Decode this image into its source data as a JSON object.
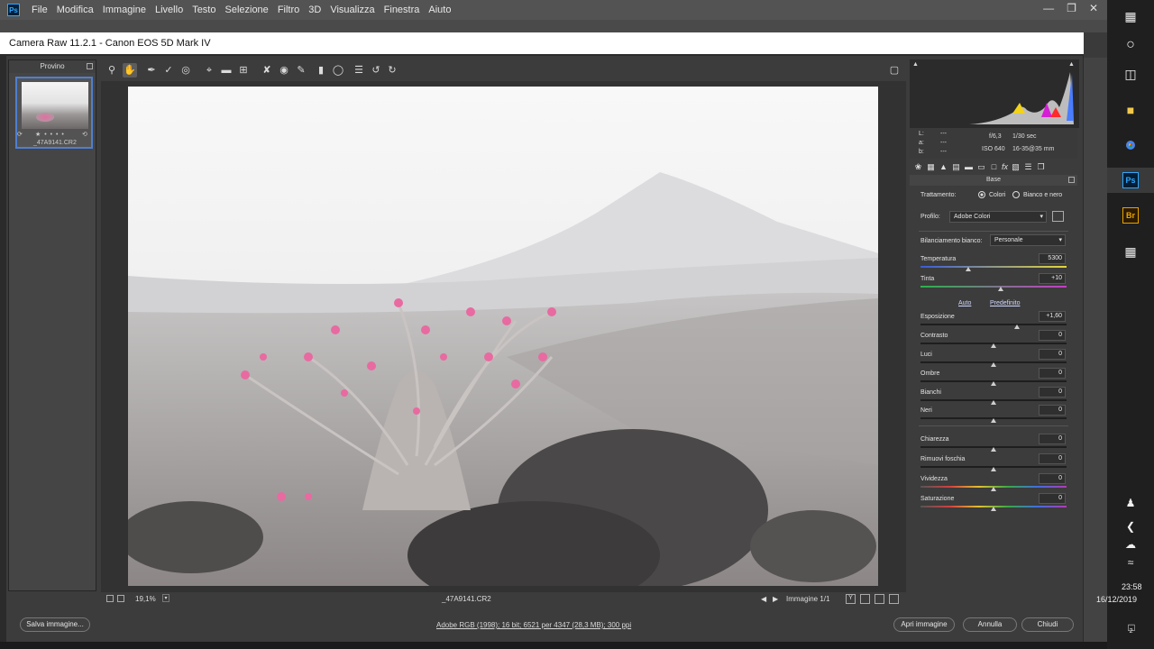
{
  "ps_menu": [
    "File",
    "Modifica",
    "Immagine",
    "Livello",
    "Testo",
    "Selezione",
    "Filtro",
    "3D",
    "Visualizza",
    "Finestra",
    "Aiuto"
  ],
  "ps_logo": "Ps",
  "window_title": "Camera Raw 11.2.1  -  Canon EOS 5D Mark IV",
  "filmstrip": {
    "title": "Provino",
    "filename": "_47A9141.CR2",
    "stars": "★ • • • •"
  },
  "readout": {
    "L": "L:",
    "a": "a:",
    "b": "b:",
    "dash": "---",
    "aperture": "f/6,3",
    "shutter": "1/30 sec",
    "iso": "ISO 640",
    "lens": "16-35@35 mm"
  },
  "panel": {
    "title": "Base",
    "treatment_label": "Trattamento:",
    "treatment_color": "Colori",
    "treatment_bw": "Bianco e nero",
    "profile_label": "Profilo:",
    "profile_value": "Adobe Colori",
    "wb_label": "Bilanciamento bianco:",
    "wb_value": "Personale",
    "auto": "Auto",
    "default": "Predefinito",
    "sliders": [
      {
        "label": "Temperatura",
        "value": "5300",
        "pos": 0.33
      },
      {
        "label": "Tinta",
        "value": "+10",
        "pos": 0.55
      },
      {
        "label": "Esposizione",
        "value": "+1,60",
        "pos": 0.66
      },
      {
        "label": "Contrasto",
        "value": "0",
        "pos": 0.5
      },
      {
        "label": "Luci",
        "value": "0",
        "pos": 0.5
      },
      {
        "label": "Ombre",
        "value": "0",
        "pos": 0.5
      },
      {
        "label": "Bianchi",
        "value": "0",
        "pos": 0.5
      },
      {
        "label": "Neri",
        "value": "0",
        "pos": 0.5
      },
      {
        "label": "Chiarezza",
        "value": "0",
        "pos": 0.5
      },
      {
        "label": "Rimuovi foschia",
        "value": "0",
        "pos": 0.5
      },
      {
        "label": "Vividezza",
        "value": "0",
        "pos": 0.5
      },
      {
        "label": "Saturazione",
        "value": "0",
        "pos": 0.5
      }
    ]
  },
  "image_status": {
    "zoom": "19,1%",
    "filename": "_47A9141.CR2",
    "counter": "Immagine 1/1"
  },
  "bottom": {
    "save": "Salva immagine...",
    "workflow": "Adobe RGB (1998); 16 bit; 6521 per 4347 (28,3 MB); 300 ppi",
    "open": "Apri immagine",
    "cancel": "Annulla",
    "done": "Chiudi"
  },
  "clock": {
    "time": "23:58",
    "date": "16/12/2019"
  },
  "notification_count": "2",
  "colors": {
    "accent": "#4f7fd1",
    "ps_blue": "#31a8ff",
    "bridge": "#e8a300"
  }
}
